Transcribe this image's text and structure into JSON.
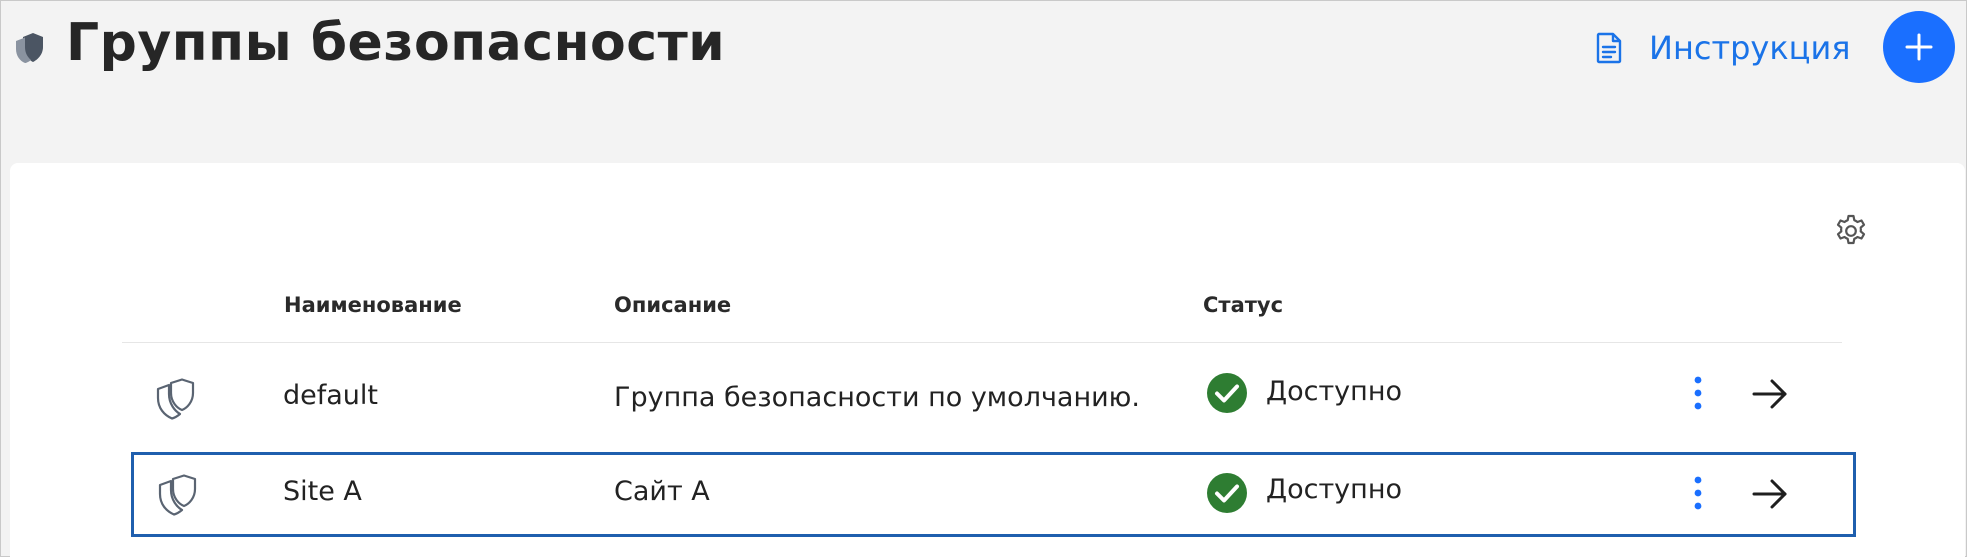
{
  "header": {
    "title": "Группы безопасности",
    "guide_label": "Инструкция",
    "add_button": "+"
  },
  "table": {
    "columns": [
      "Наименование",
      "Описание",
      "Статус"
    ],
    "rows": [
      {
        "name": "default",
        "description": "Группа безопасности по умолчанию.",
        "status": "Доступно",
        "selected": false
      },
      {
        "name": "Site A",
        "description": "Сайт А",
        "status": "Доступно",
        "selected": true
      }
    ]
  },
  "colors": {
    "accent": "#1a6fff",
    "link": "#1a73e8",
    "status_ok": "#2e7d32",
    "selection_border": "#1f5fae",
    "page_bg": "#f3f3f3"
  },
  "icons": {
    "header": "shield-icon",
    "guide": "document-icon",
    "add": "plus-icon",
    "settings": "gear-icon",
    "row": "shield-outline-icon",
    "status": "check-circle-icon",
    "more": "more-vertical-icon",
    "open": "arrow-right-icon"
  }
}
